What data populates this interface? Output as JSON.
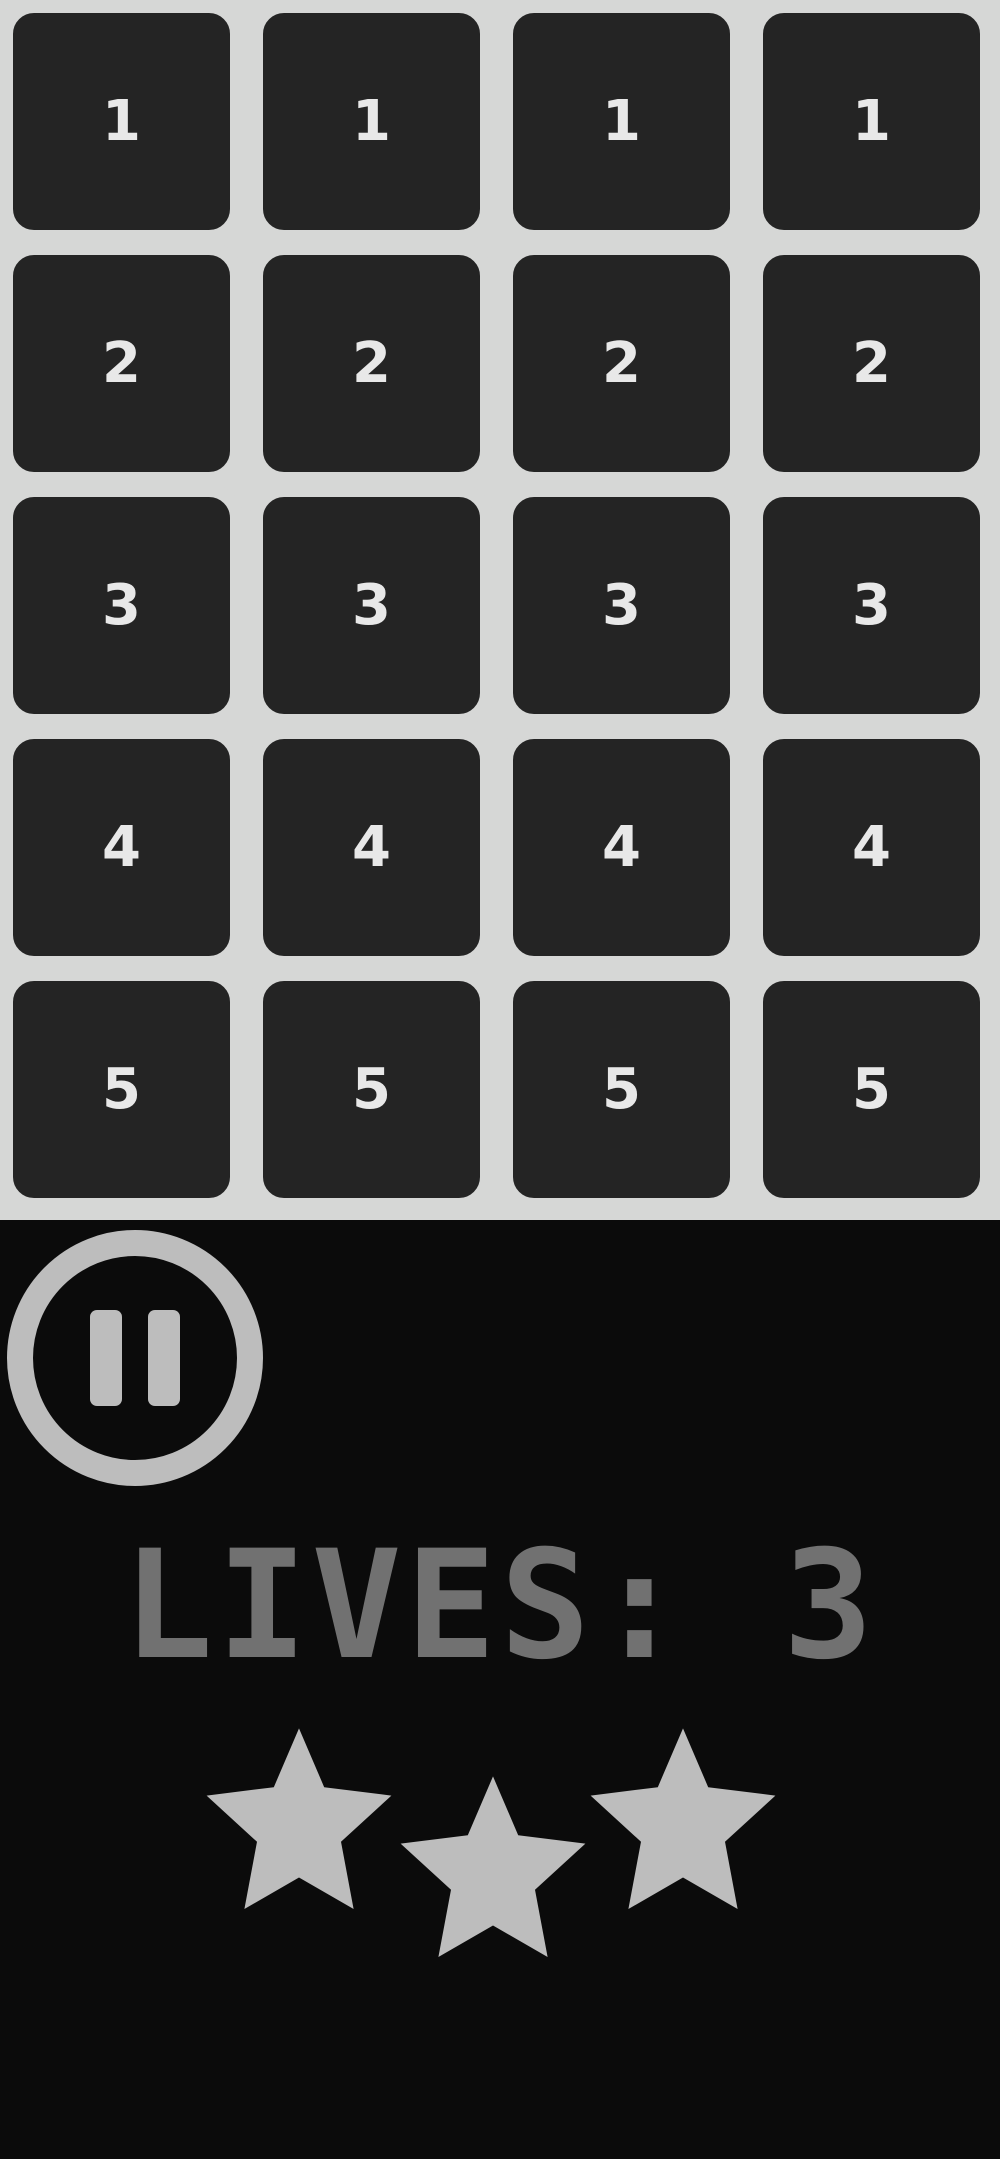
{
  "grid": {
    "rows": [
      [
        "1",
        "1",
        "1",
        "1"
      ],
      [
        "2",
        "2",
        "2",
        "2"
      ],
      [
        "3",
        "3",
        "3",
        "3"
      ],
      [
        "4",
        "4",
        "4",
        "4"
      ],
      [
        "5",
        "5",
        "5",
        "5"
      ]
    ]
  },
  "hud": {
    "lives_label": "LIVES:",
    "lives_value": "3",
    "stars_filled": 3,
    "stars_total": 3,
    "pause_icon": "pause-icon"
  },
  "colors": {
    "background": "#0b0b0b",
    "tile": "#242424",
    "tile_border": "#d6d7d6",
    "tile_text": "#e8e8e8",
    "hud_light": "#bdbdbd",
    "lives_text": "#717171"
  }
}
